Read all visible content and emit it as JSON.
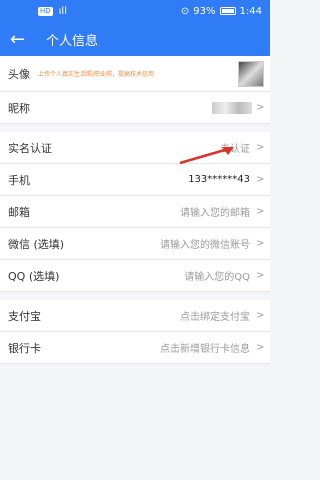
{
  "status": {
    "left_chip": "HD",
    "signal": "ıll",
    "right_icon": "⊙",
    "battery": "93%",
    "time": "1:44"
  },
  "nav": {
    "back_icon": "←",
    "title": "个人信息"
  },
  "rows": {
    "avatar": {
      "label": "头像",
      "hint": "上传个人真实生活照/职业照，提高技术信用"
    },
    "nickname": {
      "label": "昵称"
    },
    "realname": {
      "label": "实名认证",
      "value": "去认证"
    },
    "phone": {
      "label": "手机",
      "value": "133******43"
    },
    "email": {
      "label": "邮箱",
      "value": "请输入您的邮箱"
    },
    "wechat": {
      "label": "微信 (选填)",
      "value": "请输入您的微信账号"
    },
    "qq": {
      "label": "QQ (选填)",
      "value": "请输入您的QQ"
    },
    "alipay": {
      "label": "支付宝",
      "value": "点击绑定支付宝"
    },
    "bank": {
      "label": "银行卡",
      "value": "点击新增银行卡信息"
    }
  },
  "chevron": ">",
  "colors": {
    "accent": "#2f7cf6",
    "arrow": "#d9342b"
  }
}
